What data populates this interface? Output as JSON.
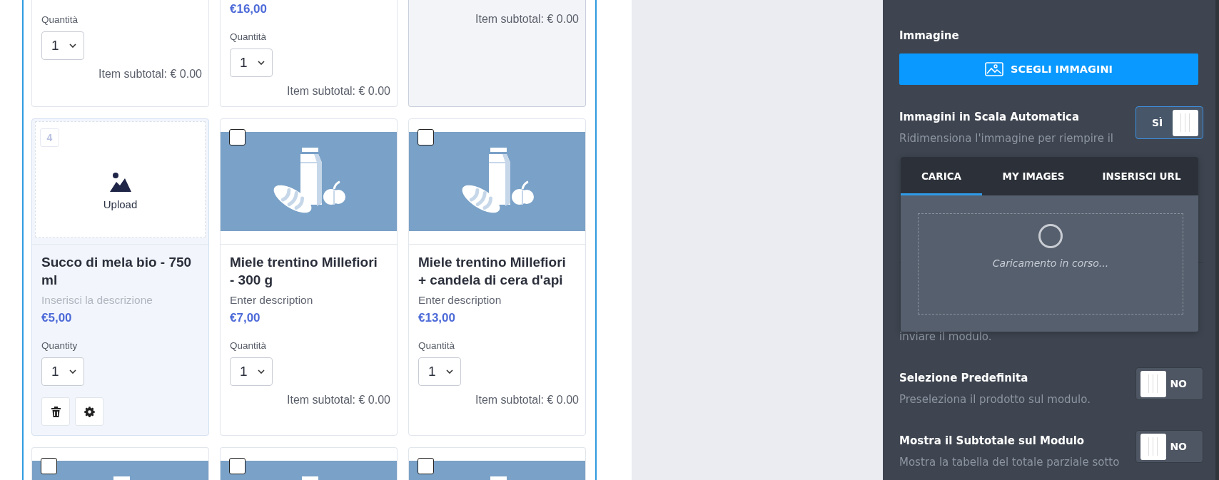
{
  "form": {
    "rows": [
      {
        "cards": [
          {
            "kind": "text",
            "selected": false,
            "hovered": false,
            "quantity_label": "Quantità",
            "quantity": "1",
            "subtotal": "Item subtotal: € 0.00"
          },
          {
            "kind": "text",
            "selected": false,
            "hovered": false,
            "price": "€16,00",
            "quantity_label": "Quantità",
            "quantity": "1",
            "subtotal": "Item subtotal: € 0.00"
          },
          {
            "kind": "text",
            "selected": false,
            "hovered": true,
            "subtotal": "Item subtotal: € 0.00"
          }
        ]
      },
      {
        "cards": [
          {
            "kind": "upload",
            "selected": true,
            "hovered": false,
            "number": "4",
            "upload_label": "Upload",
            "title": "Succo di mela bio - 750 ml",
            "description_placeholder": "Inserisci la descrizione",
            "price": "€5,00",
            "quantity_label": "Quantity",
            "quantity": "1",
            "actions": [
              {
                "kind": "delete"
              },
              {
                "kind": "settings"
              }
            ]
          },
          {
            "kind": "image",
            "selected": false,
            "hovered": false,
            "checked": false,
            "title": "Miele trentino Millefiori - 300 g",
            "description": "Enter description",
            "price": "€7,00",
            "quantity_label": "Quantità",
            "quantity": "1",
            "subtotal": "Item subtotal: € 0.00"
          },
          {
            "kind": "image",
            "selected": false,
            "hovered": false,
            "checked": false,
            "title": "Miele trentino Millefiori + candela di cera d'api",
            "description": "Enter description",
            "price": "€13,00",
            "quantity_label": "Quantità",
            "quantity": "1",
            "subtotal": "Item subtotal: € 0.00"
          }
        ]
      },
      {
        "cards": [
          {
            "kind": "image",
            "selected": false,
            "hovered": false,
            "checked": false
          },
          {
            "kind": "image",
            "selected": false,
            "hovered": false,
            "checked": false
          },
          {
            "kind": "image",
            "selected": false,
            "hovered": false,
            "checked": false
          }
        ]
      }
    ]
  },
  "panel": {
    "image_label": "Immagine",
    "choose_button": "SCEGLI IMMAGINI",
    "settings": [
      {
        "label": "Immagini in Scala Automatica",
        "description": "Ridimensiona l'immagine per riempire il",
        "toggle": {
          "on": true,
          "text": "SÌ"
        }
      },
      {
        "description": "inviare il modulo."
      },
      {
        "label": "Selezione Predefinita",
        "description": "Preseleziona il prodotto sul modulo.",
        "toggle": {
          "on": false,
          "text": "NO"
        }
      },
      {
        "label": "Mostra il Subtotale sul Modulo",
        "description": "Mostra la tabella del totale parziale sotto",
        "toggle": {
          "on": false,
          "text": "NO"
        }
      }
    ],
    "upload_popup": {
      "tabs": [
        {
          "label": "CARICA",
          "selected": true
        },
        {
          "label": "MY IMAGES",
          "selected": false
        },
        {
          "label": "INSERISCI URL",
          "selected": false
        }
      ],
      "status": "Caricamento in corso..."
    }
  }
}
